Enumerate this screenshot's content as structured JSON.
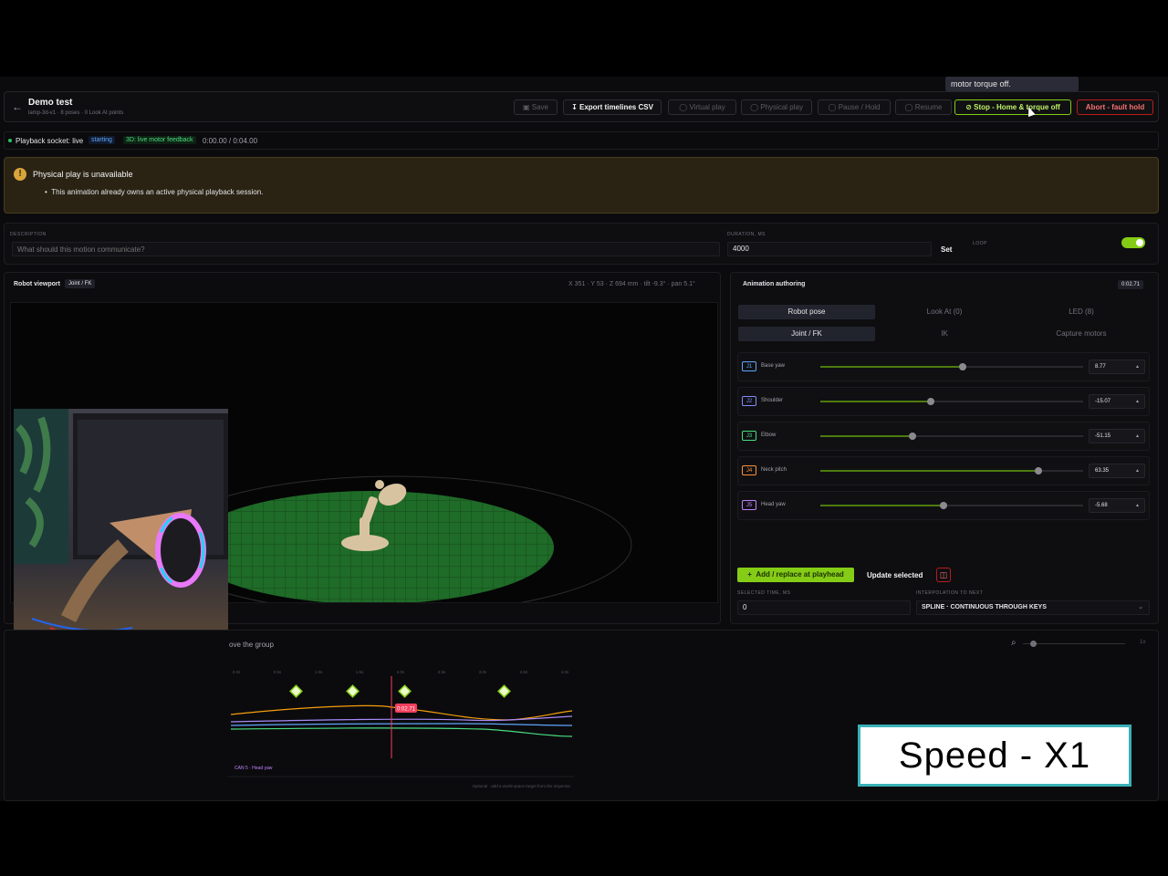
{
  "tooltip": "motor torque off.",
  "header": {
    "title": "Demo test",
    "subtitle": "lamp-3d-v1 · 8 poses · 0 Look At points",
    "buttons": {
      "save": "Save",
      "export": "Export timelines CSV",
      "virtual_play": "Virtual play",
      "physical_play": "Physical play",
      "pause": "Pause / Hold",
      "resume": "Resume",
      "stop": "Stop - Home & torque off",
      "abort": "Abort - fault hold"
    }
  },
  "status": {
    "socket": "Playback socket: live",
    "state": "starting",
    "feedback": "3D: live motor feedback",
    "time": "0:00.00 / 0:04.00"
  },
  "warning": {
    "title": "Physical play is unavailable",
    "detail": "This animation already owns an active physical playback session."
  },
  "meta": {
    "description_label": "DESCRIPTION",
    "description_placeholder": "What should this motion communicate?",
    "duration_label": "DURATION, MS",
    "duration_value": "4000",
    "set_label": "Set",
    "loop_label": "LOOP",
    "loop_on": true
  },
  "viewport": {
    "title": "Robot viewport",
    "mode": "Joint / FK",
    "readout": "X 351 · Y 53 · Z 694 mm · tilt -9.3° · pan 5.1°"
  },
  "authoring": {
    "title": "Animation authoring",
    "time": "0:02.71",
    "tabs": [
      "Robot pose",
      "Look At (0)",
      "LED (8)"
    ],
    "subtabs": [
      "Joint / FK",
      "IK",
      "Capture motors"
    ],
    "joints": [
      {
        "id": "J1",
        "name": "Base yaw",
        "value": "8.77",
        "fraction": 0.54,
        "color": "#60a5fa"
      },
      {
        "id": "J2",
        "name": "Shoulder",
        "value": "-15.07",
        "fraction": 0.42,
        "color": "#818cf8"
      },
      {
        "id": "J3",
        "name": "Elbow",
        "value": "-51.15",
        "fraction": 0.35,
        "color": "#4ade80"
      },
      {
        "id": "J4",
        "name": "Neck pitch",
        "value": "63.35",
        "fraction": 0.83,
        "color": "#fb923c"
      },
      {
        "id": "J5",
        "name": "Head yaw",
        "value": "-5.68",
        "fraction": 0.47,
        "color": "#c084fc"
      }
    ],
    "add_label": "Add / replace at playhead",
    "update_label": "Update selected",
    "selected_time_label": "SELECTED TIME, MS",
    "selected_time_value": "0",
    "interp_label": "INTERPOLATION TO NEXT",
    "interp_value": "SPLINE · CONTINUOUS THROUGH KEYS"
  },
  "timeline": {
    "hint": "ove the group",
    "ticks": [
      "0.0s",
      "0.5s",
      "1.0s",
      "1.5s",
      "2.0s",
      "2.5s",
      "3.0s",
      "3.5s",
      "4.0s"
    ],
    "playhead_label": "0:02.71",
    "lane_label": "CAN 5 · Head yaw",
    "footer": "Optional · add a world-space target from the inspector"
  },
  "overlay": {
    "speed": "Speed - X1"
  }
}
